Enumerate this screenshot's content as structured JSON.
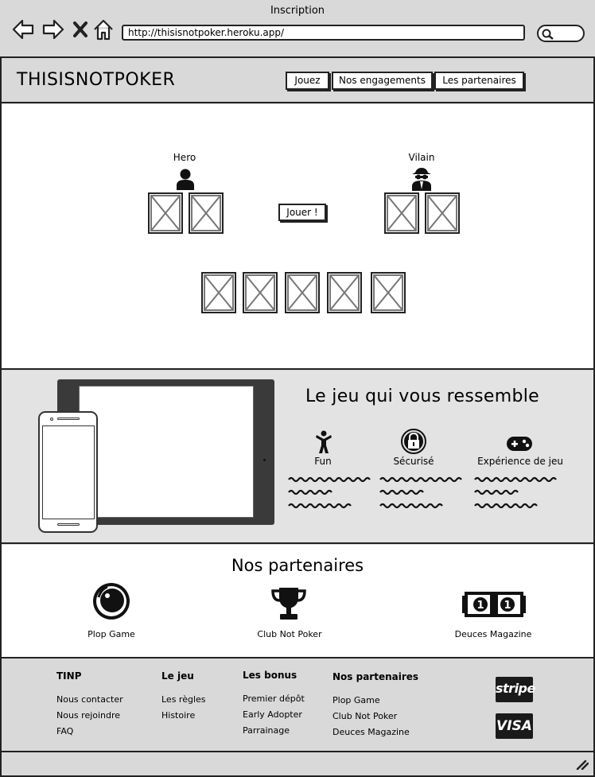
{
  "window": {
    "title": "Inscription",
    "url": "http://thisisnotpoker.heroku.app/"
  },
  "header": {
    "logo": "THISISNOTPOKER",
    "nav": [
      {
        "label": "Jouez"
      },
      {
        "label": "Nos engagements"
      },
      {
        "label": "Les partenaires"
      }
    ]
  },
  "game": {
    "hero_label": "Hero",
    "villain_label": "Vilain",
    "play_button": "Jouer !",
    "hero_cards": 2,
    "villain_cards": 2,
    "board_cards": 5
  },
  "features": {
    "title": "Le jeu qui vous ressemble",
    "items": [
      {
        "label": "Fun",
        "icon": "person-icon"
      },
      {
        "label": "Sécurisé",
        "icon": "lock-icon"
      },
      {
        "label": "Expérience de jeu",
        "icon": "gamepad-icon"
      }
    ]
  },
  "partners": {
    "title": "Nos partenaires",
    "items": [
      {
        "name": "Plop Game",
        "icon": "camera-lens-icon"
      },
      {
        "name": "Club Not Poker",
        "icon": "trophy-icon"
      },
      {
        "name": "Deuces Magazine",
        "icon": "banknote-icon"
      }
    ]
  },
  "footer": {
    "columns": [
      {
        "heading": "TINP",
        "links": [
          "Nous contacter",
          "Nous rejoindre",
          "FAQ"
        ]
      },
      {
        "heading": "Le jeu",
        "links": [
          "Les règles",
          "Histoire"
        ]
      },
      {
        "heading": "Les bonus",
        "links": [
          "Premier dépôt",
          "Early Adopter",
          "Parrainage"
        ]
      },
      {
        "heading": "Nos partenaires",
        "links": [
          "Plop Game",
          "Club Not Poker",
          "Deuces Magazine"
        ]
      }
    ],
    "payment": [
      "stripe",
      "VISA"
    ]
  }
}
